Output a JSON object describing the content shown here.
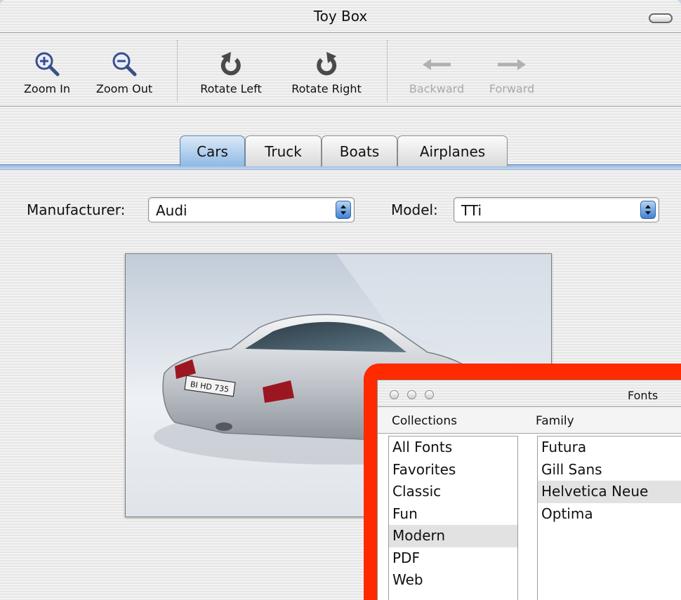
{
  "window": {
    "title": "Toy Box"
  },
  "toolbar": {
    "zoom_in": "Zoom In",
    "zoom_out": "Zoom Out",
    "rotate_left": "Rotate Left",
    "rotate_right": "Rotate Right",
    "backward": "Backward",
    "forward": "Forward"
  },
  "tabs": [
    {
      "label": "Cars",
      "active": true
    },
    {
      "label": "Truck",
      "active": false
    },
    {
      "label": "Boats",
      "active": false
    },
    {
      "label": "Airplanes",
      "active": false
    }
  ],
  "form": {
    "manufacturer_label": "Manufacturer:",
    "manufacturer_value": "Audi",
    "model_label": "Model:",
    "model_value": "TTi"
  },
  "photo": {
    "plate_text": "BI HD 735"
  },
  "fonts_panel": {
    "title": "Fonts",
    "collections_header": "Collections",
    "family_header": "Family",
    "collections": [
      "All Fonts",
      "Favorites",
      "Classic",
      "Fun",
      "Modern",
      "PDF",
      "Web"
    ],
    "selected_collection": "Modern",
    "families": [
      "Futura",
      "Gill Sans",
      "Helvetica Neue",
      "Optima"
    ],
    "selected_family": "Helvetica Neue"
  },
  "colors": {
    "highlight_frame": "#ff2a00",
    "tab_active": "#8fb9e4",
    "popup_arrows": "#3f82d2"
  }
}
